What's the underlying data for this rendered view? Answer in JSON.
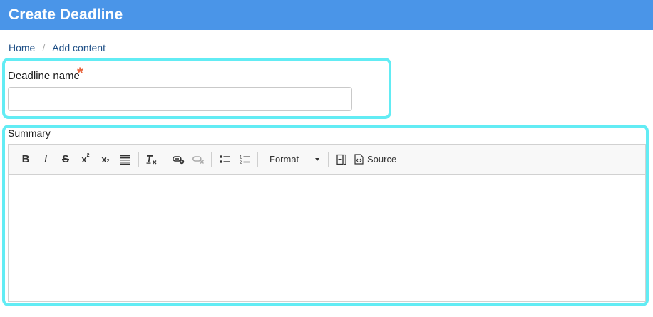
{
  "header": {
    "title": "Create Deadline"
  },
  "breadcrumb": {
    "home": "Home",
    "separator": "/",
    "current": "Add content"
  },
  "form": {
    "name_label": "Deadline name",
    "required_mark": "*",
    "name_value": "",
    "summary_label": "Summary"
  },
  "toolbar": {
    "format_label": "Format",
    "source_label": "Source",
    "buttons": [
      "bold",
      "italic",
      "strikethrough",
      "superscript",
      "subscript",
      "blockquote",
      "remove-format",
      "link",
      "unlink",
      "bulleted-list",
      "numbered-list",
      "format",
      "show-blocks",
      "source"
    ]
  },
  "colors": {
    "header": "#4a95e8",
    "highlight": "#62ecf4",
    "required": "#e8633b",
    "link": "#1e4f86"
  }
}
